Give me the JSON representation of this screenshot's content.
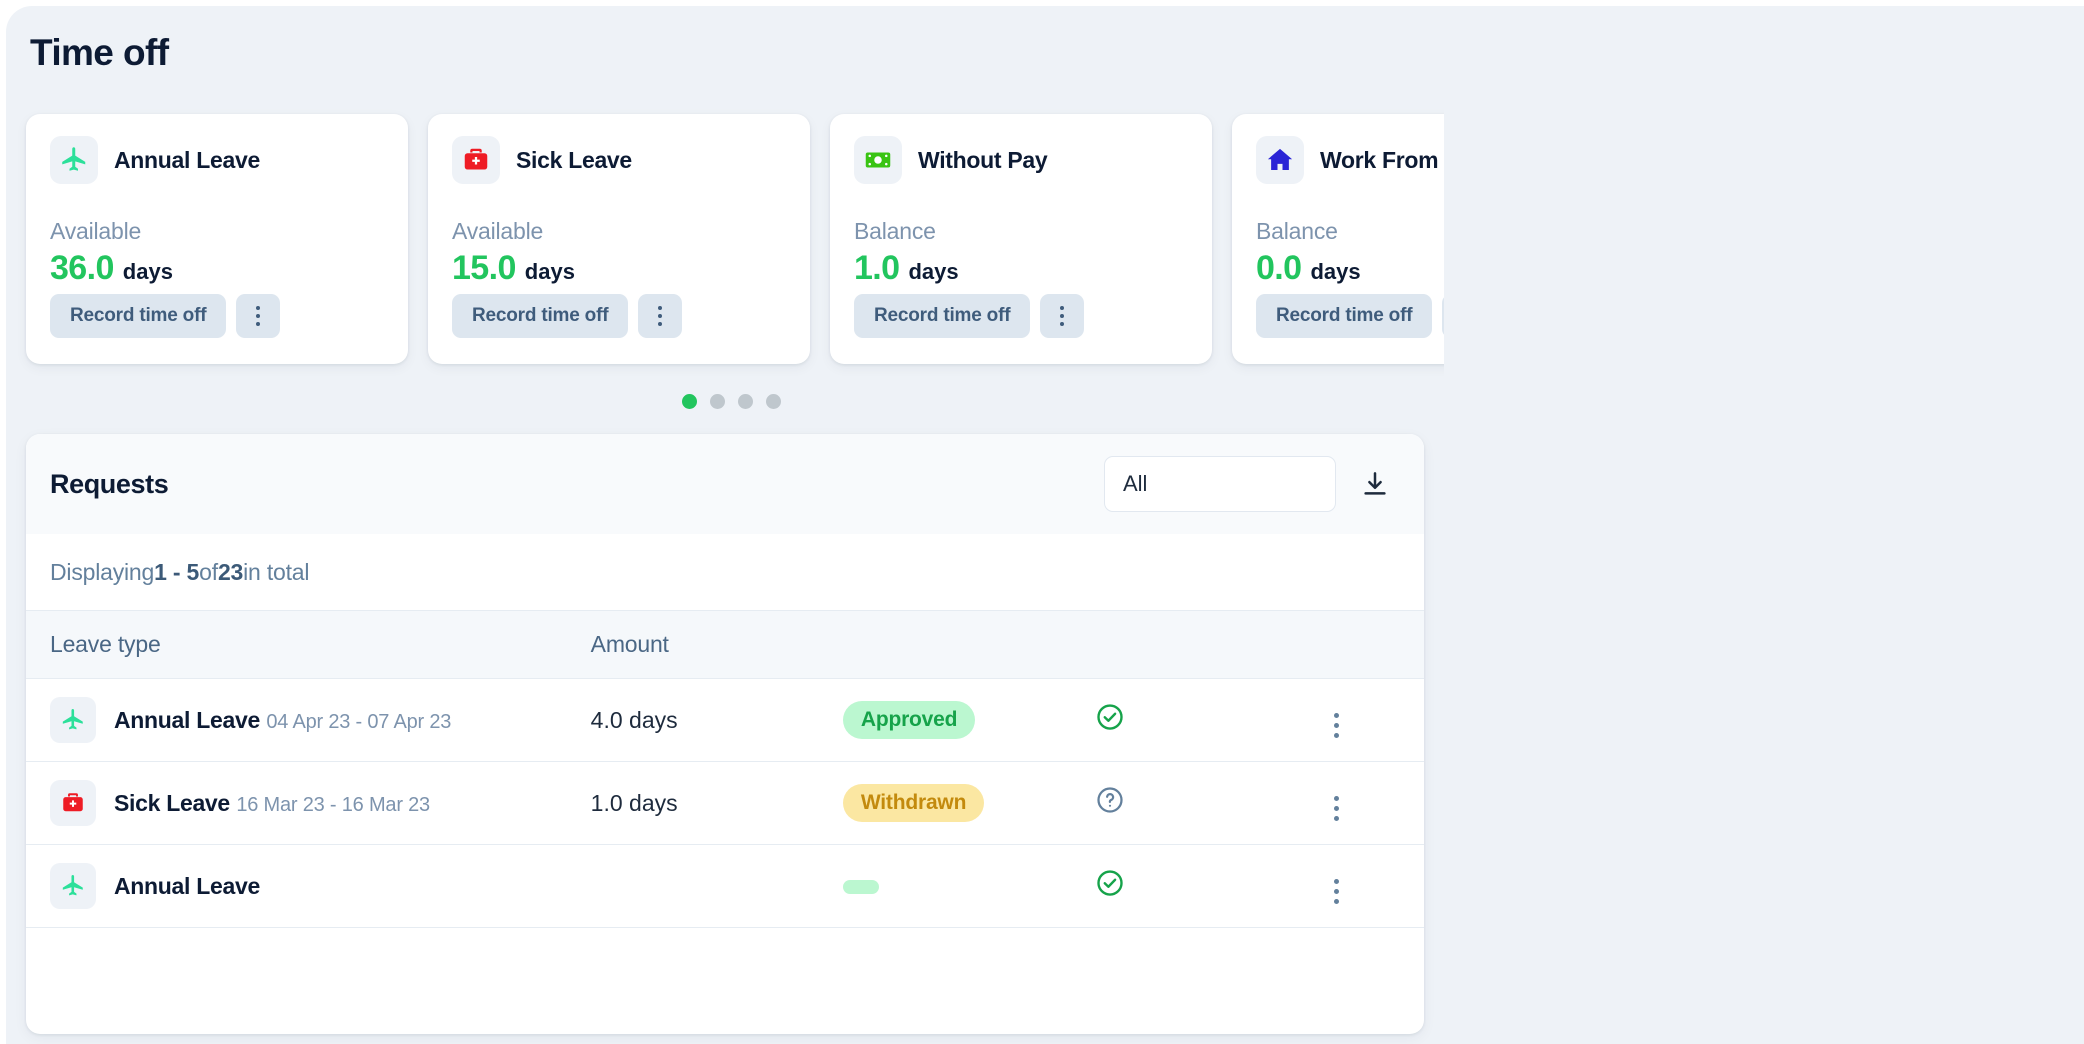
{
  "page": {
    "title": "Time off"
  },
  "balance_cards": [
    {
      "icon": "airplane-icon",
      "title": "Annual Leave",
      "label": "Available",
      "value": "36.0",
      "unit": "days",
      "record_label": "Record time off"
    },
    {
      "icon": "medical-bag-icon",
      "title": "Sick Leave",
      "label": "Available",
      "value": "15.0",
      "unit": "days",
      "record_label": "Record time off"
    },
    {
      "icon": "banknote-icon",
      "title": "Without Pay",
      "label": "Balance",
      "value": "1.0",
      "unit": "days",
      "record_label": "Record time off"
    },
    {
      "icon": "house-icon",
      "title": "Work From Home",
      "label": "Balance",
      "value": "0.0",
      "unit": "days",
      "record_label": "Record time off"
    }
  ],
  "carousel": {
    "dots": 4,
    "active_dot": 0
  },
  "requests": {
    "title": "Requests",
    "filter": {
      "selected": "All",
      "options": [
        "All"
      ]
    },
    "download_icon": "download-icon",
    "displaying": {
      "prefix": "Displaying ",
      "range": "1 - 5",
      "middle": " of ",
      "total": "23",
      "suffix": " in total"
    },
    "columns": {
      "leave_type": "Leave type",
      "amount": "Amount",
      "status": "",
      "status_icon": "",
      "menu": ""
    },
    "rows": [
      {
        "icon": "airplane-icon",
        "name": "Annual Leave",
        "dates": "04 Apr 23 - 07 Apr 23",
        "amount": "4.0 days",
        "status": "Approved",
        "status_kind": "approved",
        "status_icon": "check-circle-icon"
      },
      {
        "icon": "medical-bag-icon",
        "name": "Sick Leave",
        "dates": "16 Mar 23 - 16 Mar 23",
        "amount": "1.0 days",
        "status": "Withdrawn",
        "status_kind": "withdrawn",
        "status_icon": "question-circle-icon"
      },
      {
        "icon": "airplane-icon",
        "name": "Annual Leave",
        "dates": "",
        "amount": "",
        "status": "",
        "status_kind": "approved",
        "status_icon": "check-circle-icon"
      }
    ]
  },
  "colors": {
    "accent_green": "#22c55e",
    "title_navy": "#0d1b34",
    "muted_blue": "#7d93ad",
    "page_bg": "#eef2f7",
    "badge_approved_bg": "#bbf7d0",
    "badge_approved_fg": "#16a34a",
    "badge_withdrawn_bg": "#fbe7a2",
    "badge_withdrawn_fg": "#c38a0d",
    "sick_red": "#ee1c25",
    "wfh_blue": "#2b24d6",
    "annual_teal": "#2ce09a"
  }
}
